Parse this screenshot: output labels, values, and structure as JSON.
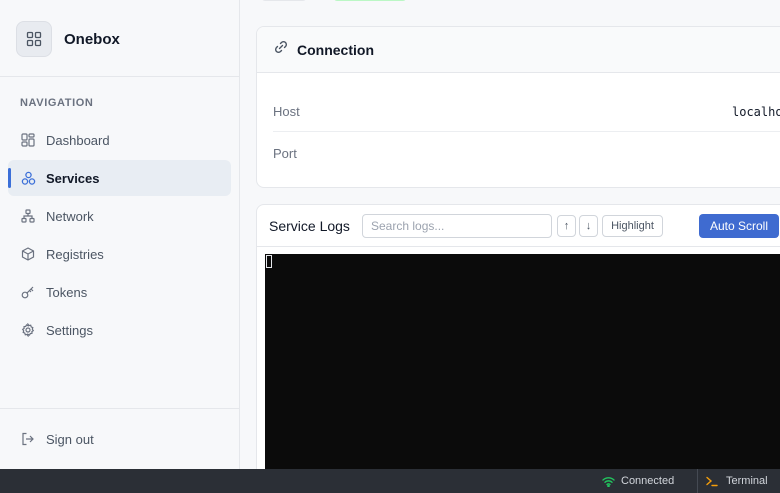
{
  "app": {
    "name": "Onebox",
    "logo_icon": "grid-icon"
  },
  "sidebar": {
    "heading": "NAVIGATION",
    "items": [
      {
        "label": "Dashboard",
        "icon": "dashboard-icon",
        "active": false
      },
      {
        "label": "Services",
        "icon": "services-icon",
        "active": true
      },
      {
        "label": "Network",
        "icon": "network-icon",
        "active": false
      },
      {
        "label": "Registries",
        "icon": "box-icon",
        "active": false
      },
      {
        "label": "Tokens",
        "icon": "key-icon",
        "active": false
      },
      {
        "label": "Settings",
        "icon": "gear-icon",
        "active": false
      }
    ],
    "signout_label": "Sign out"
  },
  "connection": {
    "title": "Connection",
    "rows": [
      {
        "key": "Host",
        "value": "localhost"
      },
      {
        "key": "Port",
        "value": ""
      }
    ]
  },
  "logs": {
    "title": "Service Logs",
    "search_placeholder": "Search logs...",
    "up_label": "↑",
    "down_label": "↓",
    "highlight_label": "Highlight",
    "autoscroll_label": "Auto Scroll"
  },
  "statusbar": {
    "connection_status": "Connected",
    "terminal_label": "Terminal"
  },
  "colors": {
    "accent": "#3f6bd0",
    "status_ok": "#22c55e",
    "terminal_bg": "#0b0b0b",
    "terminal_prompt": "#f59e0b"
  }
}
